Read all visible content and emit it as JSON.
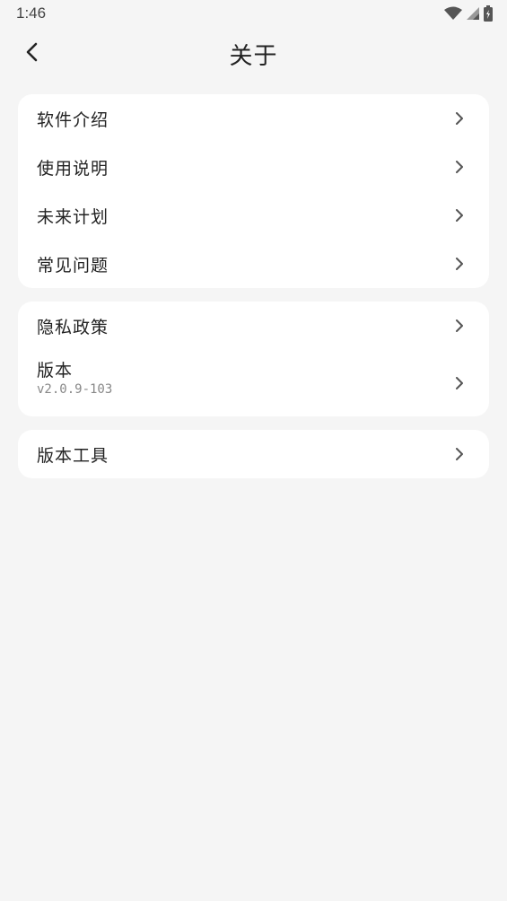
{
  "status": {
    "time": "1:46",
    "icons": [
      "wifi-icon",
      "signal-icon",
      "battery-icon"
    ]
  },
  "header": {
    "title": "关于",
    "back_icon": "back-arrow-icon"
  },
  "groups": [
    {
      "items": [
        {
          "label": "软件介绍"
        },
        {
          "label": "使用说明"
        },
        {
          "label": "未来计划"
        },
        {
          "label": "常见问题"
        }
      ]
    },
    {
      "items": [
        {
          "label": "隐私政策"
        },
        {
          "label": "版本",
          "sub": "v2.0.9-103"
        }
      ]
    },
    {
      "items": [
        {
          "label": "版本工具"
        }
      ]
    }
  ],
  "colors": {
    "background": "#f5f5f5",
    "card": "#ffffff",
    "text": "#222222",
    "subtext": "#888888",
    "chevron": "#555555"
  }
}
